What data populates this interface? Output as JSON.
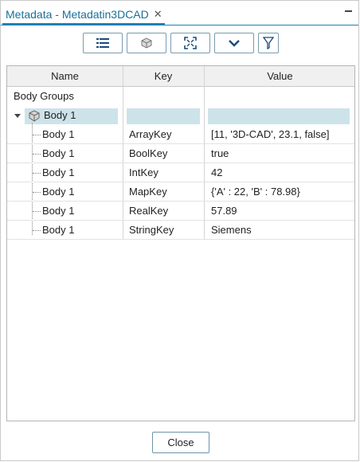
{
  "tab": {
    "title": "Metadata - Metadatin3DCAD",
    "close_glyph": "✕"
  },
  "toolbar": {
    "buttons": [
      {
        "icon": "list-icon"
      },
      {
        "icon": "part-icon"
      },
      {
        "icon": "fit-icon"
      },
      {
        "icon": "chevron-down-icon"
      },
      {
        "icon": "filter-icon"
      }
    ]
  },
  "grid": {
    "columns": [
      "Name",
      "Key",
      "Value"
    ],
    "group_label": "Body Groups",
    "parent": {
      "name": "Body 1"
    },
    "rows": [
      {
        "name": "Body 1",
        "key": "ArrayKey",
        "value": "[11, '3D-CAD', 23.1, false]"
      },
      {
        "name": "Body 1",
        "key": "BoolKey",
        "value": "true"
      },
      {
        "name": "Body 1",
        "key": "IntKey",
        "value": "42"
      },
      {
        "name": "Body 1",
        "key": "MapKey",
        "value": "{'A' : 22, 'B' : 78.98}"
      },
      {
        "name": "Body 1",
        "key": "RealKey",
        "value": "57.89"
      },
      {
        "name": "Body 1",
        "key": "StringKey",
        "value": "Siemens"
      }
    ]
  },
  "footer": {
    "close_label": "Close"
  },
  "colors": {
    "accent": "#1f7fb4",
    "selection": "#cde3ea"
  }
}
